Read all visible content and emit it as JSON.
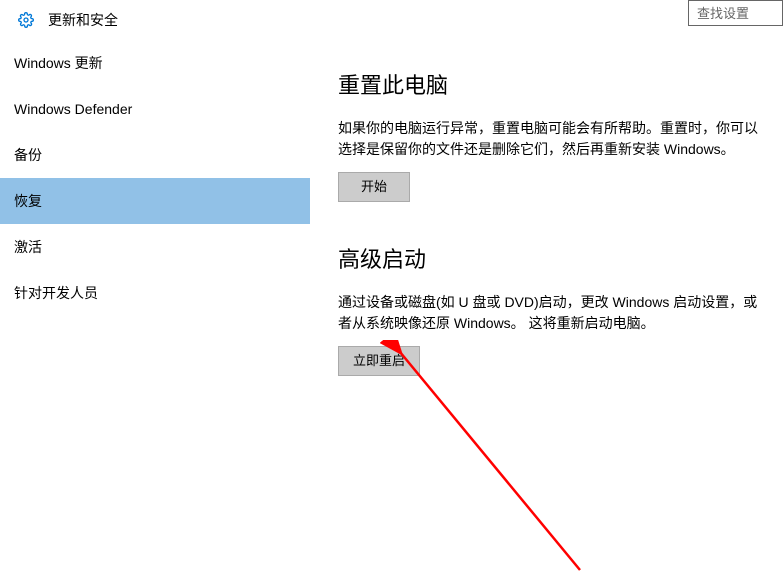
{
  "header": {
    "title": "更新和安全",
    "search_placeholder": "查找设置"
  },
  "sidebar": {
    "items": [
      {
        "label": "Windows 更新"
      },
      {
        "label": "Windows Defender"
      },
      {
        "label": "备份"
      },
      {
        "label": "恢复"
      },
      {
        "label": "激活"
      },
      {
        "label": "针对开发人员"
      }
    ],
    "active_index": 3
  },
  "content": {
    "reset": {
      "title": "重置此电脑",
      "desc": "如果你的电脑运行异常，重置电脑可能会有所帮助。重置时，你可以选择是保留你的文件还是删除它们，然后再重新安装 Windows。",
      "button": "开始"
    },
    "advanced": {
      "title": "高级启动",
      "desc": "通过设备或磁盘(如 U 盘或 DVD)启动，更改 Windows 启动设置，或者从系统映像还原 Windows。 这将重新启动电脑。",
      "button": "立即重启"
    }
  }
}
